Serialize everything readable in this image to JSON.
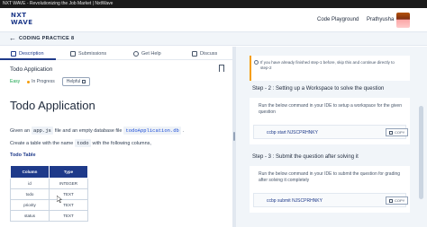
{
  "window": {
    "title": "NXT WAVE - Revolutionizing the Job Market | NxtWave"
  },
  "brand": {
    "logo_line1": "NXT",
    "logo_line2": "WAVE"
  },
  "nav": {
    "code_playground": "Code Playground",
    "user_name": "Prathyusha"
  },
  "practice": {
    "title": "CODING PRACTICE 8"
  },
  "tabs": [
    {
      "label": "Description",
      "icon": "document-icon",
      "active": true
    },
    {
      "label": "Submissions",
      "icon": "list-icon",
      "active": false
    },
    {
      "label": "Get Help",
      "icon": "help-icon",
      "active": false
    },
    {
      "label": "Discuss",
      "icon": "chat-icon",
      "active": false
    }
  ],
  "question": {
    "title": "Todo Application",
    "difficulty": "Easy",
    "status": "In Progress",
    "helpful_label": "Helpful",
    "heading": "Todo Application",
    "p1_before": "Given an",
    "p1_code1": "app.js",
    "p1_mid": "file and an empty database file",
    "p1_code2": "todoApplication.db",
    "p1_end": ".",
    "p2_before": "Create a table with the name",
    "p2_code": "todo",
    "p2_after": "with the following columns,",
    "table_title": "Todo Table",
    "table_headers": [
      "Column",
      "Type"
    ],
    "table_rows": [
      [
        "id",
        "INTEGER"
      ],
      [
        "todo",
        "TEXT"
      ],
      [
        "priority",
        "TEXT"
      ],
      [
        "status",
        "TEXT"
      ]
    ]
  },
  "instructions": {
    "note": "If you have already finished step-1 before, skip this and continue directly to step-2",
    "step2": {
      "title": "Step - 2 : Setting up a Workspace to solve the question",
      "desc": "Run the below command in your IDE to setup a workspace for the given question",
      "command": "ccbp start NJSCPRHNKY",
      "copy_label": "COPY"
    },
    "step3": {
      "title": "Step - 3 : Submit the question after solving it",
      "desc": "Run the below command in your IDE to submit the question for grading after solving it completely",
      "command": "ccbp submit NJSCPRHNKY",
      "copy_label": "COPY"
    }
  },
  "colors": {
    "primary": "#1e3a8a",
    "easy": "#16a34a",
    "in_progress": "#f59e0b"
  }
}
